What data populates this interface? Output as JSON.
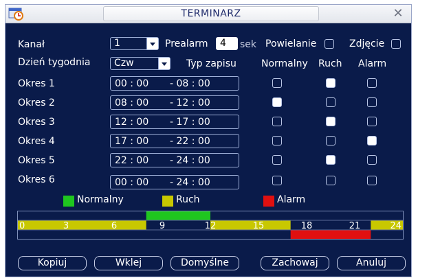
{
  "window": {
    "title": "TERMINARZ",
    "close_symbol": "✕"
  },
  "form": {
    "channel_label": "Kanał",
    "channel_value": "1",
    "prealarm_label": "Prealarm",
    "prealarm_value": "4",
    "prealarm_unit": "sek",
    "duplicate_label": "Powielanie",
    "duplicate_checked": false,
    "snapshot_label": "Zdjęcie",
    "snapshot_checked": false,
    "weekday_label": "Dzień tygodnia",
    "weekday_value": "Czw",
    "record_type_label": "Typ zapisu",
    "col_normal": "Normalny",
    "col_motion": "Ruch",
    "col_alarm": "Alarm"
  },
  "periods": [
    {
      "label": "Okres 1",
      "start": "00 : 00",
      "end": "- 08 : 00",
      "normal": false,
      "motion": true,
      "alarm": false
    },
    {
      "label": "Okres 2",
      "start": "08 : 00",
      "end": "- 12 : 00",
      "normal": true,
      "motion": false,
      "alarm": false
    },
    {
      "label": "Okres 3",
      "start": "12 : 00",
      "end": "- 17 : 00",
      "normal": false,
      "motion": true,
      "alarm": false
    },
    {
      "label": "Okres 4",
      "start": "17 : 00",
      "end": "- 22 : 00",
      "normal": false,
      "motion": false,
      "alarm": true
    },
    {
      "label": "Okres 5",
      "start": "22 : 00",
      "end": "- 24 : 00",
      "normal": false,
      "motion": true,
      "alarm": false
    },
    {
      "label": "Okres 6",
      "start": "00 : 00",
      "end": "- 24 : 00",
      "normal": false,
      "motion": false,
      "alarm": false
    }
  ],
  "legend": [
    {
      "label": "Normalny",
      "color": "#1fc61f"
    },
    {
      "label": "Ruch",
      "color": "#c8c800"
    },
    {
      "label": "Alarm",
      "color": "#e01010"
    }
  ],
  "timeline": {
    "tick_labels": [
      "0",
      "3",
      "6",
      "9",
      "12",
      "15",
      "18",
      "21",
      "24"
    ],
    "hours_total": 24,
    "bands": [
      {
        "type": "Ruch",
        "start": 0,
        "end": 8,
        "color": "#c8c800"
      },
      {
        "type": "Normalny",
        "start": 8,
        "end": 12,
        "color": "#1fc61f"
      },
      {
        "type": "Ruch",
        "start": 12,
        "end": 17,
        "color": "#c8c800"
      },
      {
        "type": "Alarm",
        "start": 17,
        "end": 22,
        "color": "#e01010"
      },
      {
        "type": "Ruch",
        "start": 22,
        "end": 24,
        "color": "#c8c800"
      }
    ]
  },
  "buttons": {
    "copy": "Kopiuj",
    "paste": "Wklej",
    "default": "Domyślne",
    "save": "Zachowaj",
    "cancel": "Anuluj"
  }
}
